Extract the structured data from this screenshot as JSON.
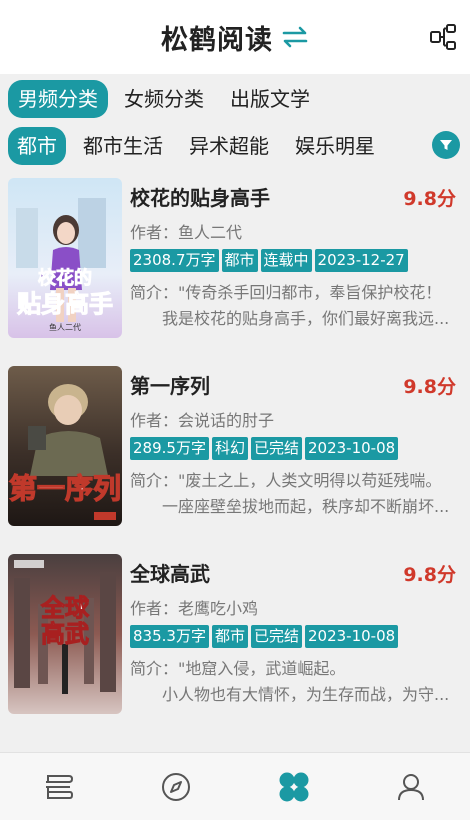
{
  "header": {
    "title": "松鹤阅读"
  },
  "categories": [
    {
      "label": "男频分类",
      "active": true
    },
    {
      "label": "女频分类",
      "active": false
    },
    {
      "label": "出版文学",
      "active": false
    }
  ],
  "subcategories": [
    {
      "label": "都市",
      "active": true
    },
    {
      "label": "都市生活",
      "active": false
    },
    {
      "label": "异术超能",
      "active": false
    },
    {
      "label": "娱乐明星",
      "active": false
    }
  ],
  "books": [
    {
      "title": "校花的贴身高手",
      "score": "9.8分",
      "author": "作者：鱼人二代",
      "tags": [
        "2308.7万字",
        "都市",
        "连载中",
        "2023-12-27"
      ],
      "intro_line1": "简介：\"传奇杀手回归都市，奉旨保护校花！",
      "intro_line2": "我是校花的贴身高手，你们最好离我远...",
      "cover_text": "校花的贴身高手",
      "cover_author": "鱼人二代"
    },
    {
      "title": "第一序列",
      "score": "9.8分",
      "author": "作者：会说话的肘子",
      "tags": [
        "289.5万字",
        "科幻",
        "已完结",
        "2023-10-08"
      ],
      "intro_line1": "简介：\"废土之上，人类文明得以苟延残喘。",
      "intro_line2": "一座座壁垒拔地而起，秩序却不断崩坏...",
      "cover_text": "第一序列"
    },
    {
      "title": "全球高武",
      "score": "9.8分",
      "author": "作者：老鹰吃小鸡",
      "tags": [
        "835.3万字",
        "都市",
        "已完结",
        "2023-10-08"
      ],
      "intro_line1": "简介：\"地窟入侵，武道崛起。",
      "intro_line2": "小人物也有大情怀，为生存而战，为守...",
      "cover_text": "全球高武"
    }
  ],
  "nav": [
    {
      "icon": "bookshelf-icon"
    },
    {
      "icon": "compass-icon"
    },
    {
      "icon": "category-icon",
      "active": true
    },
    {
      "icon": "user-icon"
    }
  ],
  "colors": {
    "accent": "#1b99a3",
    "score": "#d0392b"
  }
}
